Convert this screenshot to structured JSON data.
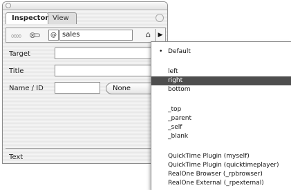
{
  "tabs": {
    "inspector": "Inspector",
    "view": "View"
  },
  "toolbar": {
    "at_symbol": "@",
    "link_field_value": "sales",
    "folder_icon": "folder-icon",
    "menu_arrow": "▶"
  },
  "fields": {
    "target_label": "Target",
    "title_label": "Title",
    "name_id_label": "Name / ID",
    "name_id_popup": "None",
    "text_label": "Text"
  },
  "menu": {
    "check_mark": "•",
    "items": [
      "Default",
      "left",
      "right",
      "bottom",
      "_top",
      "_parent",
      "_self",
      "_blank",
      "QuickTime Plugin (myself)",
      "QuickTime Plugin (quicktimeplayer)",
      "RealOne Browser (_rpbrowser)",
      "RealOne External (_rpexternal)"
    ],
    "selected_index": 2,
    "checked_index": 0
  },
  "colors": {
    "selection_bg": "#4e4e4e",
    "selection_text": "#ffffff"
  }
}
